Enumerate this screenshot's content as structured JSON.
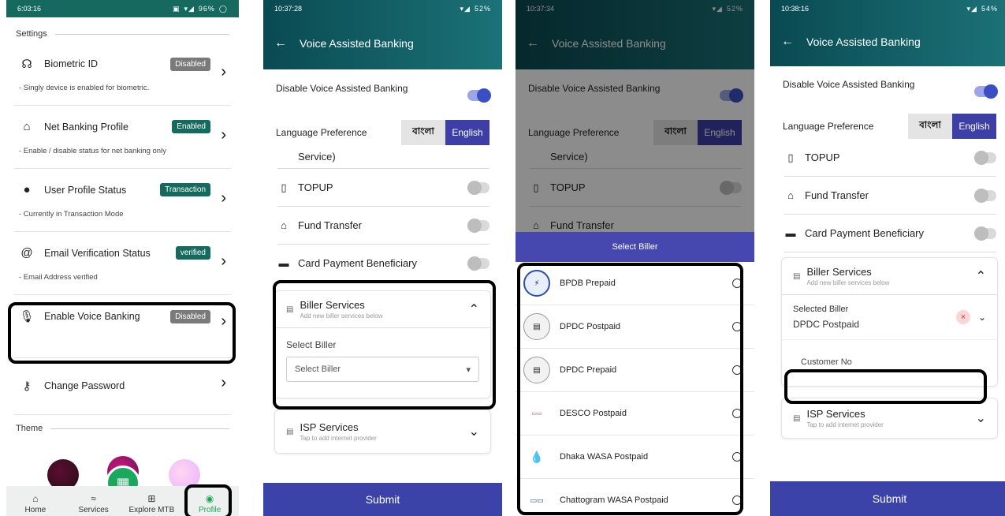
{
  "colors": {
    "teal": "#16695f",
    "indigo": "#3d3fa6",
    "badge_gray": "#7a7a7a",
    "badge_green": "#146a5c"
  },
  "phone1": {
    "status_time": "6:03:16",
    "status_right": "96%",
    "settings_title": "Settings",
    "items": [
      {
        "icon": "fingerprint-icon",
        "label": "Biometric ID",
        "badge": "Disabled",
        "sub": "- Singly device is enabled for biometric."
      },
      {
        "icon": "bank-icon",
        "label": "Net Banking Profile",
        "badge": "Enabled",
        "sub": "- Enable / disable status for net banking only"
      },
      {
        "icon": "user-check-icon",
        "label": "User Profile Status",
        "badge": "Transaction",
        "sub": "- Currently in Transaction Mode"
      },
      {
        "icon": "at-icon",
        "label": "Email Verification Status",
        "badge": "verified",
        "sub": "- Email Address verified"
      },
      {
        "icon": "mic-icon",
        "label": "Enable Voice Banking",
        "badge": "Disabled",
        "sub": ""
      },
      {
        "icon": "key-icon",
        "label": "Change Password",
        "badge": "",
        "sub": ""
      }
    ],
    "theme_title": "Theme",
    "nav": [
      "Home",
      "Services",
      "Explore MTB",
      "Profile"
    ]
  },
  "phone2": {
    "status_time": "10:37:28",
    "status_right": "52%",
    "title": "Voice Assisted Banking",
    "disable_label": "Disable Voice Assisted Banking",
    "lang_label": "Language Preference",
    "lang_bn": "বাংলা",
    "lang_en": "English",
    "partial_item": "Service)",
    "items": [
      "TOPUP",
      "Fund Transfer",
      "Card Payment Beneficiary"
    ],
    "biller_title": "Biller Services",
    "biller_sub": "Add new biller services below",
    "select_label": "Select Biller",
    "select_value": "Select Biller",
    "isp_title": "ISP Services",
    "isp_sub": "Tap to add internet provider",
    "submit": "Submit"
  },
  "phone3": {
    "status_time": "10:37:34",
    "status_right": "52%",
    "sheet_title": "Select Biller",
    "billers": [
      "BPDB Prepaid",
      "DPDC Postpaid",
      "DPDC Prepaid",
      "DESCO Postpaid",
      "Dhaka WASA Postpaid",
      "Chattogram WASA Postpaid"
    ]
  },
  "phone4": {
    "status_time": "10:38:16",
    "status_right": "54%",
    "selected_label": "Selected Biller",
    "selected_value": "DPDC Postpaid",
    "customer_placeholder": "Customer No"
  }
}
